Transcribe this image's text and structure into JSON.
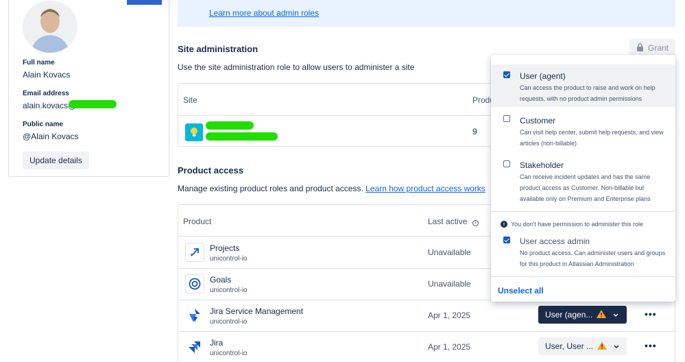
{
  "profile": {
    "full_name_label": "Full name",
    "full_name": "Alain Kovacs",
    "email_label": "Email address",
    "email": "alain.kovacs@",
    "public_name_label": "Public name",
    "public_name": "@Alain Kovacs",
    "update_button": "Update details"
  },
  "banner": {
    "link": "Learn more about admin roles"
  },
  "site_admin": {
    "title": "Site administration",
    "description": "Use the site administration role to allow users to administer a site",
    "grant_button": "Grant",
    "columns": {
      "site": "Site",
      "products": "Produ"
    },
    "row": {
      "products_count": "9"
    }
  },
  "product_access": {
    "title": "Product access",
    "description": "Manage existing product roles and product access.",
    "description_link": "Learn how product access works",
    "columns": {
      "product": "Product",
      "last_active": "Last active"
    },
    "rows": [
      {
        "name": "Projects",
        "site": "unicontrol-io",
        "last_active": "Unavailable"
      },
      {
        "name": "Goals",
        "site": "unicontrol-io",
        "last_active": "Unavailable"
      },
      {
        "name": "Jira Service Management",
        "site": "unicontrol-io",
        "last_active": "Apr 1, 2025",
        "role": "User (agen..."
      },
      {
        "name": "Jira",
        "site": "unicontrol-io",
        "last_active": "Apr 1, 2025",
        "role": "User, User ..."
      }
    ],
    "more_label": "•••"
  },
  "role_dropdown": {
    "options": [
      {
        "title": "User (agent)",
        "desc": "Can access the product to raise and work on help requests, with no product admin permissions",
        "checked": true
      },
      {
        "title": "Customer",
        "desc": "Can visit help center, submit help requests, and view articles (non-billable)",
        "checked": false
      },
      {
        "title": "Stakeholder",
        "desc": "Can receive incident updates and has the same product access as Customer. Non-billable but available only on Premium and Enterprise plans",
        "checked": false
      }
    ],
    "note": "You don't have permission to administer this role",
    "admin_option": {
      "title": "User access admin",
      "desc": "No product access. Can administer users and groups for this product in Atlassian Administration",
      "checked": true
    },
    "unselect_all": "Unselect all"
  },
  "colors": {
    "accent": "#0c66e4",
    "dark_button": "#1d2b4a",
    "warning": "#f5a623",
    "redaction": "#22dd00"
  }
}
